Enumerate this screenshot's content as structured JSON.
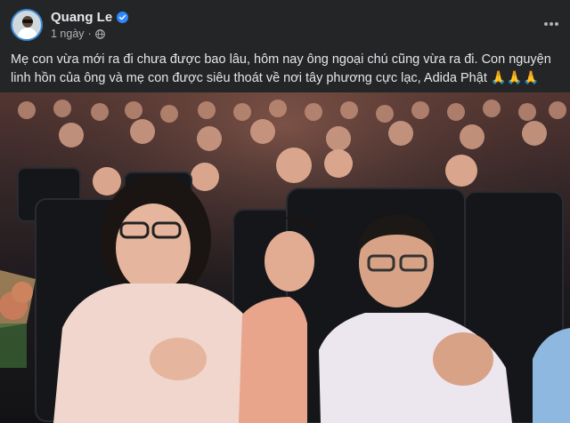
{
  "post": {
    "author_name": "Quang Le",
    "timestamp": "1 ngày",
    "separator": "·",
    "privacy_icon": "globe-icon",
    "verified_icon": "verified-badge-icon",
    "more_icon": "more-options-icon",
    "caption": "Mẹ con vừa mới ra đi chưa được bao lâu, hôm nay ông ngoại chú cũng vừa ra đi.  Con nguyện linh hồn của ông và mẹ con được siêu thoát về nơi tây phương cực lạc, Adida Phật 🙏🙏🙏"
  },
  "colors": {
    "background": "#242526",
    "text_primary": "#e4e6eb",
    "text_secondary": "#b0b3b8",
    "verified_blue": "#2d88ff"
  }
}
